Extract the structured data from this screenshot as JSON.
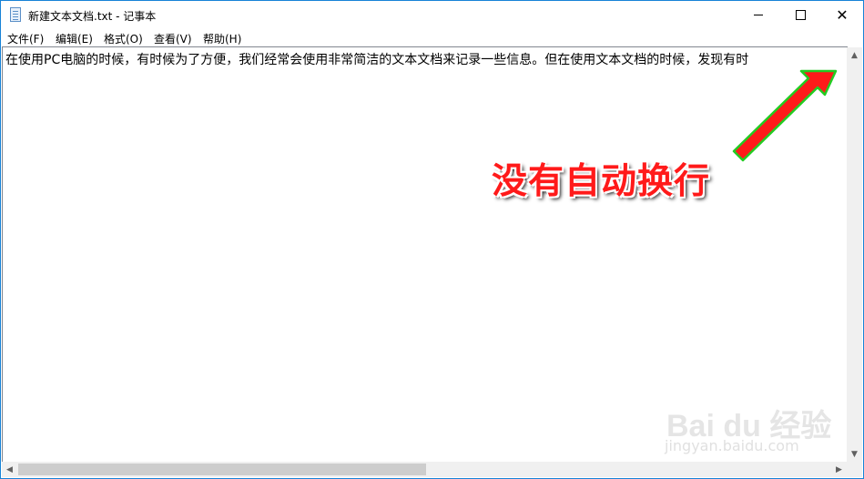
{
  "window": {
    "title": "新建文本文档.txt - 记事本",
    "controls": {
      "minimize": "minimize",
      "maximize": "maximize",
      "close": "✕"
    }
  },
  "menu": [
    {
      "label": "文件(F)"
    },
    {
      "label": "编辑(E)"
    },
    {
      "label": "格式(O)"
    },
    {
      "label": "查看(V)"
    },
    {
      "label": "帮助(H)"
    }
  ],
  "editor": {
    "text": "在使用PC电脑的时候，有时候为了方便，我们经常会使用非常简洁的文本文档来记录一些信息。但在使用文本文档的时候，发现有时"
  },
  "scrollbars": {
    "up_arrow": "▲",
    "down_arrow": "▼",
    "left_arrow": "◀",
    "right_arrow": "▶"
  },
  "annotation": {
    "label": "没有自动换行",
    "color": "#ff1a1a",
    "outline_color": "#22cc22"
  },
  "watermark": {
    "brand": "Bai du 经验",
    "url": "jingyan.baidu.com"
  }
}
